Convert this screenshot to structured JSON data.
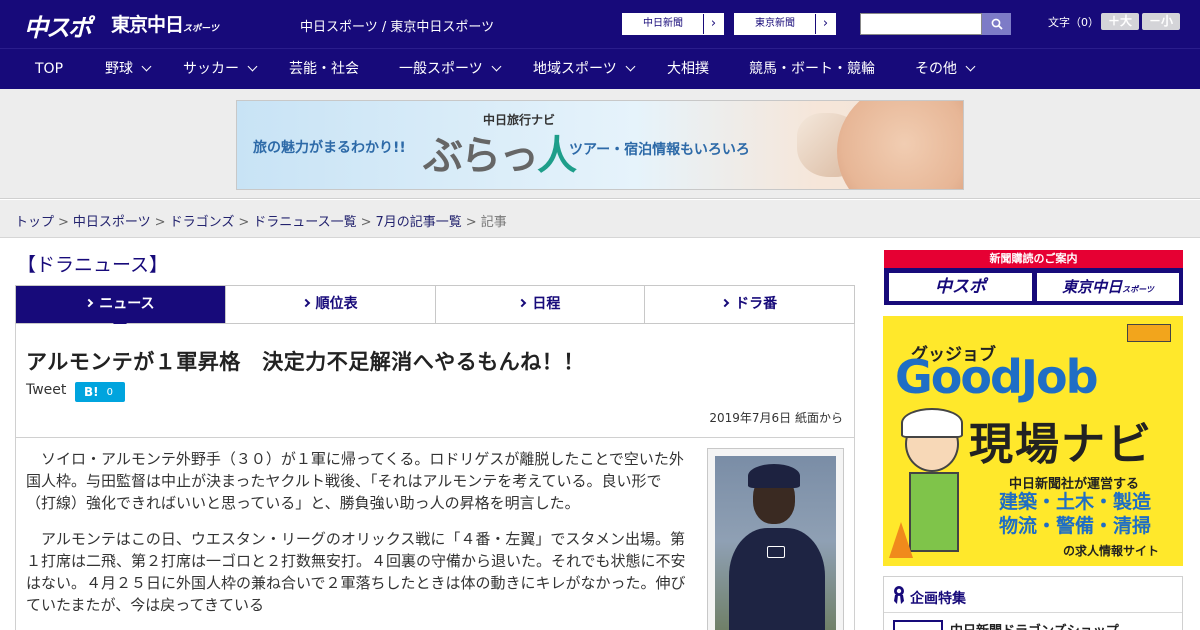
{
  "header": {
    "logo_chuspo": "中スポ",
    "logo_tokyo": "東京中日",
    "logo_tokyo_small": "スポーツ",
    "site_title": "中日スポーツ / 東京中日スポーツ",
    "ext_links": [
      {
        "label": "中日新聞",
        "arrow": "›"
      },
      {
        "label": "東京新聞",
        "arrow": "›"
      }
    ],
    "search": {
      "value": "",
      "placeholder": ""
    },
    "font_size_label": "文字（0）",
    "font_size_up": "＋大",
    "font_size_down": "－小"
  },
  "nav": {
    "items": [
      {
        "label": "TOP",
        "has_dropdown": false
      },
      {
        "label": "野球",
        "has_dropdown": true
      },
      {
        "label": "サッカー",
        "has_dropdown": true
      },
      {
        "label": "芸能・社会",
        "has_dropdown": false
      },
      {
        "label": "一般スポーツ",
        "has_dropdown": true
      },
      {
        "label": "地域スポーツ",
        "has_dropdown": true
      },
      {
        "label": "大相撲",
        "has_dropdown": false
      },
      {
        "label": "競馬・ボート・競輪",
        "has_dropdown": false
      },
      {
        "label": "その他",
        "has_dropdown": true
      }
    ]
  },
  "ad_banner": {
    "text_left": "旅の魅力がまるわかり!!",
    "brand_small": "中日旅行ナビ",
    "brand_big_1": "ぶらっ",
    "brand_big_2": "人",
    "text_right": "ツアー・宿泊情報もいろいろ"
  },
  "breadcrumb": {
    "items": [
      "トップ",
      "中日スポーツ",
      "ドラゴンズ",
      "ドラニュース一覧",
      "7月の記事一覧"
    ],
    "current": "記事",
    "separator": ">"
  },
  "main": {
    "section_title": "【ドラニュース】",
    "tabs": [
      {
        "label": "ニュース",
        "active": true
      },
      {
        "label": "順位表",
        "active": false
      },
      {
        "label": "日程",
        "active": false
      },
      {
        "label": "ドラ番",
        "active": false
      }
    ],
    "article": {
      "headline": "アルモンテが１軍昇格　決定力不足解消へやるもんね！！",
      "tweet_label": "Tweet",
      "hatena_label": "B!",
      "hatena_count": "0",
      "date": "2019年7月6日 紙面から",
      "paragraphs": [
        "ソイロ・アルモンテ外野手（３０）が１軍に帰ってくる。ロドリゲスが離脱したことで空いた外国人枠。与田監督は中止が決まったヤクルト戦後、「それはアルモンテを考えている。良い形で（打線）強化できればいいと思っている」と、勝負強い助っ人の昇格を明言した。",
        "アルモンテはこの日、ウエスタン・リーグのオリックス戦に「４番・左翼」でスタメン出場。第１打席は二飛、第２打席は一ゴロと２打数無安打。４回裏の守備から退いた。それでも状態に不安はない。４月２５日に外国人枠の兼ね合いで２軍落ちしたときは体の動きにキレがなかった。伸びていたまたが、今は戻ってきている"
      ]
    }
  },
  "sidebar": {
    "subscription": {
      "heading": "新聞購読のご案内",
      "btn_chuspo": "中スポ",
      "btn_tokyo": "東京中日",
      "btn_tokyo_small": "スポーツ"
    },
    "job_ad": {
      "kana": "グッジョブ",
      "title": "GoodJob",
      "navi": "現場ナビ",
      "operator": "中日新聞社が運営する",
      "industries_1": "建築・土木・製造",
      "industries_2": "物流・警備・清掃",
      "tagline": "の求人情報サイト"
    },
    "feature": {
      "title": "企画特集",
      "item": "中日新聞ドラゴンズショップ"
    }
  },
  "colors": {
    "brand_navy": "#170a7a",
    "tab_active": "#170a7a",
    "subscription_red": "#e60033",
    "hatena_blue": "#00a4de",
    "jobad_yellow": "#ffe82b",
    "jobad_blue": "#1f6ec5"
  },
  "icons": {
    "search_button": "search-icon",
    "ext_link_arrow": "chevron-right-icon",
    "nav_dropdown": "chevron-down-icon",
    "tab_marker": "chevron-right-icon",
    "feature": "ribbon-icon"
  }
}
